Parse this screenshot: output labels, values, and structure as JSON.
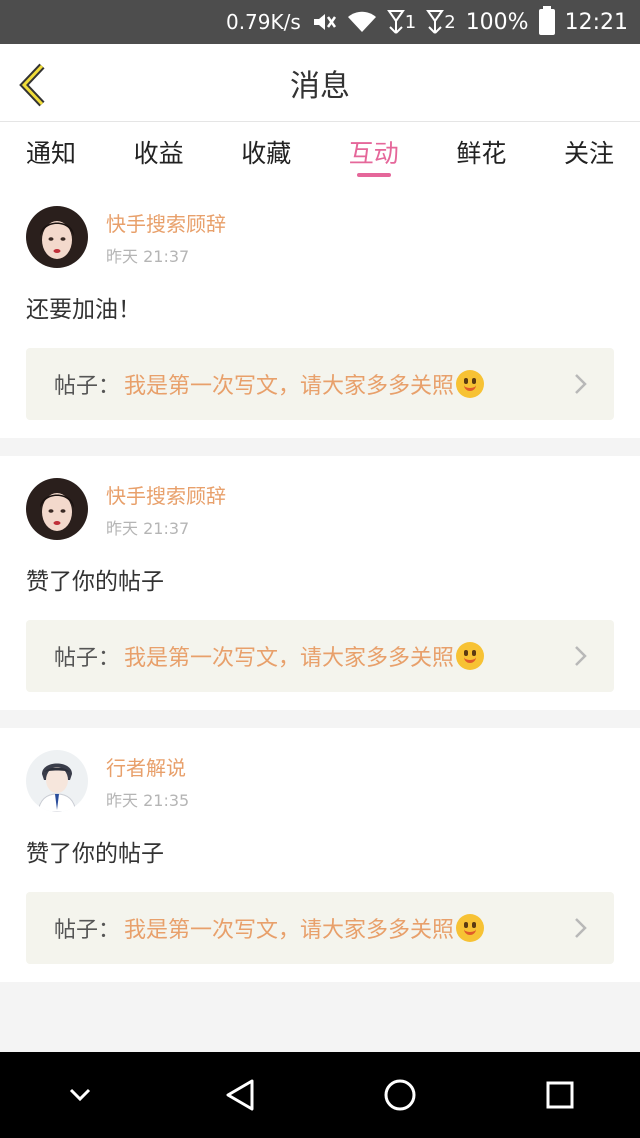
{
  "status_bar": {
    "speed": "0.79K/s",
    "sim1": "1",
    "sim2": "2",
    "battery": "100%",
    "time": "12:21",
    "icons": [
      "mute-icon",
      "wifi-icon",
      "signal-icon",
      "battery-icon"
    ]
  },
  "header": {
    "title": "消息",
    "back_icon": "chevron-left-icon"
  },
  "tabs": [
    {
      "label": "通知",
      "active": false
    },
    {
      "label": "收益",
      "active": false
    },
    {
      "label": "收藏",
      "active": false
    },
    {
      "label": "互动",
      "active": true
    },
    {
      "label": "鲜花",
      "active": false
    },
    {
      "label": "关注",
      "active": false
    }
  ],
  "feed": [
    {
      "user": "快手搜索顾辞",
      "time": "昨天 21:37",
      "text": "还要加油！",
      "post_label": "帖子：",
      "post_title": "我是第一次写文，请大家多多关照"
    },
    {
      "user": "快手搜索顾辞",
      "time": "昨天 21:37",
      "text": "赞了你的帖子",
      "post_label": "帖子：",
      "post_title": "我是第一次写文，请大家多多关照"
    },
    {
      "user": "行者解说",
      "time": "昨天 21:35",
      "text": "赞了你的帖子",
      "post_label": "帖子：",
      "post_title": "我是第一次写文，请大家多多关照"
    }
  ],
  "colors": {
    "accent": "#e5679a",
    "username": "#e8a06b",
    "post_box": "#f4f4ed"
  }
}
